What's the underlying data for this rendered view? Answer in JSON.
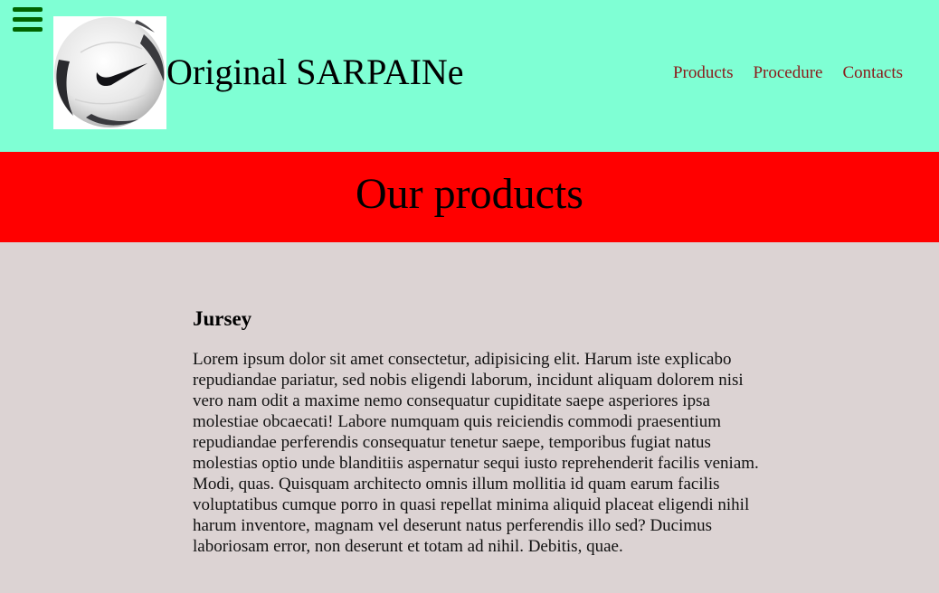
{
  "header": {
    "title": "Original SARPAINe",
    "menu_icon": "hamburger-menu-icon",
    "logo": "soccer-ball-logo",
    "nav": [
      {
        "label": "Products"
      },
      {
        "label": "Procedure"
      },
      {
        "label": "Contacts"
      }
    ]
  },
  "banner": {
    "title": "Our products"
  },
  "section": {
    "heading": "Jursey",
    "body": "Lorem ipsum dolor sit amet consectetur, adipisicing elit. Harum iste explicabo repudiandae pariatur, sed nobis eligendi laborum, incidunt aliquam dolorem nisi vero nam odit a maxime nemo consequatur cupiditate saepe asperiores ipsa molestiae obcaecati! Labore numquam quis reiciendis commodi praesentium repudiandae perferendis consequatur tenetur saepe, temporibus fugiat natus molestias optio unde blanditiis aspernatur sequi iusto reprehenderit facilis veniam. Modi, quas. Quisquam architecto omnis illum mollitia id quam earum facilis voluptatibus cumque porro in quasi repellat minima aliquid placeat eligendi nihil harum inventore, magnam vel deserunt natus perferendis illo sed? Ducimus laboriosam error, non deserunt et totam ad nihil. Debitis, quae."
  },
  "colors": {
    "header_bg": "#7fffd4",
    "banner_bg": "#ff0000",
    "page_bg": "#dcd3d3",
    "nav_link": "#8b1a1a",
    "menu_icon": "#006400"
  }
}
